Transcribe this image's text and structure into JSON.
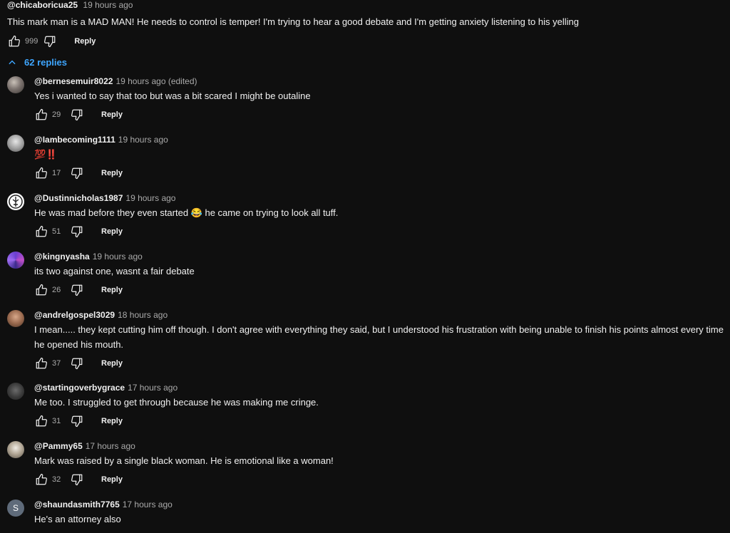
{
  "top_comment": {
    "author": "@chicaboricua25",
    "time": "19 hours ago",
    "text": "This mark man is a MAD MAN! He needs to control is temper! I'm trying to hear a good debate and I'm getting anxiety listening to his yelling",
    "likes": "999",
    "reply_label": "Reply"
  },
  "replies_toggle": {
    "label": "62 replies"
  },
  "replies": [
    {
      "author": "@bernesemuir8022",
      "time": "19 hours ago (edited)",
      "text": "Yes i wanted to say that too but was a bit scared I might be outaline",
      "likes": "29",
      "reply_label": "Reply",
      "avatar": "photo-gray"
    },
    {
      "author": "@Iambecoming1111",
      "time": "19 hours ago",
      "text": "💯‼️",
      "likes": "17",
      "reply_label": "Reply",
      "avatar": "photo-light"
    },
    {
      "author": "@Dustinnicholas1987",
      "time": "19 hours ago",
      "text": "He was mad before they even started 😂  he came on trying to look all tuff.",
      "likes": "51",
      "reply_label": "Reply",
      "avatar": "emblem-white"
    },
    {
      "author": "@kingnyasha",
      "time": "19 hours ago",
      "text": "its two  against one, wasnt a fair debate",
      "likes": "26",
      "reply_label": "Reply",
      "avatar": "purple-art"
    },
    {
      "author": "@andrelgospel3029",
      "time": "18 hours ago",
      "text": "I mean..... they kept cutting him off though. I don't agree with everything they said, but I understood his frustration with being unable to finish his points almost every time he opened his mouth.",
      "likes": "37",
      "reply_label": "Reply",
      "avatar": "photo-brown"
    },
    {
      "author": "@startingoverbygrace",
      "time": "17 hours ago",
      "text": "Me too. I struggled to get through because he was making me cringe.",
      "likes": "31",
      "reply_label": "Reply",
      "avatar": "photo-dark"
    },
    {
      "author": "@Pammy65",
      "time": "17 hours ago",
      "text": "Mark was raised by a single black woman. He is emotional like a woman!",
      "likes": "32",
      "reply_label": "Reply",
      "avatar": "photo-dog"
    },
    {
      "author": "@shaundasmith7765",
      "time": "17 hours ago",
      "text": "He's an attorney also",
      "likes": "",
      "reply_label": "",
      "avatar": "letter",
      "avatar_letter": "S"
    }
  ],
  "colors": {
    "background": "#0f0f0f",
    "text": "#f1f1f1",
    "muted": "#aaaaaa",
    "link": "#3ea6ff",
    "avatar_letter_bg": "#5f6b7a"
  },
  "icons": {
    "like": "thumb-up-icon",
    "dislike": "thumb-down-icon",
    "toggle": "chevron-up-icon"
  }
}
